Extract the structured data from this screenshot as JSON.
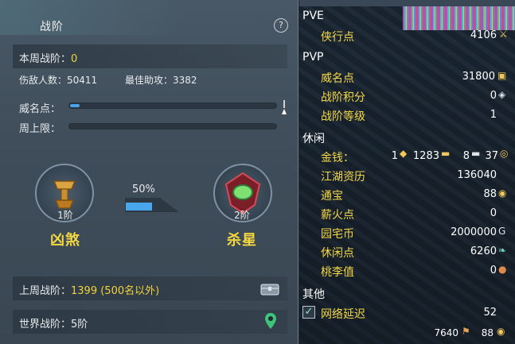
{
  "left_panel": {
    "title": "战阶",
    "help_icon": "?",
    "weekly_rank_label": "本周战阶：",
    "weekly_rank_value": "0",
    "kills_label": "伤敌人数：",
    "kills_value": "50411",
    "best_assist_label": "最佳助攻：",
    "best_assist_value": "3382",
    "prestige_label": "威名点：",
    "weekly_cap_label": "周上限：",
    "progress_percent": "50%",
    "current_rank": {
      "level": "1阶",
      "name": "凶煞"
    },
    "next_rank": {
      "level": "2阶",
      "name": "杀星"
    },
    "last_week_label": "上周战阶：",
    "last_week_value": "1399 (500名以外)",
    "world_rank_label": "世界战阶：",
    "world_rank_value": "5阶"
  },
  "right_panel": {
    "pve_header": "PVE",
    "xiaxing_label": "侠行点",
    "xiaxing_value": "4106",
    "pvp_header": "PVP",
    "weiming_label": "威名点",
    "weiming_value": "31800",
    "zhanjie_score_label": "战阶积分",
    "zhanjie_score_value": "0",
    "zhanjie_level_label": "战阶等级",
    "zhanjie_level_value": "1",
    "leisure_header": "休闲",
    "money_label": "金钱：",
    "money_gold_ingot": "1",
    "money_gold": "1283",
    "money_silver": "8",
    "money_copper": "37",
    "jianghu_label": "江湖资历",
    "jianghu_value": "136040",
    "tongbao_label": "通宝",
    "tongbao_value": "88",
    "xinhuo_label": "薪火点",
    "xinhuo_value": "0",
    "yuanzhai_label": "园宅币",
    "yuanzhai_value": "2000000",
    "xiuxian_label": "休闲点",
    "xiuxian_value": "6260",
    "taoli_label": "桃李值",
    "taoli_value": "0",
    "other_header": "其他",
    "latency_label": "网络延迟",
    "latency_value": "52",
    "footer_value_1": "7640",
    "footer_value_2": "88"
  }
}
